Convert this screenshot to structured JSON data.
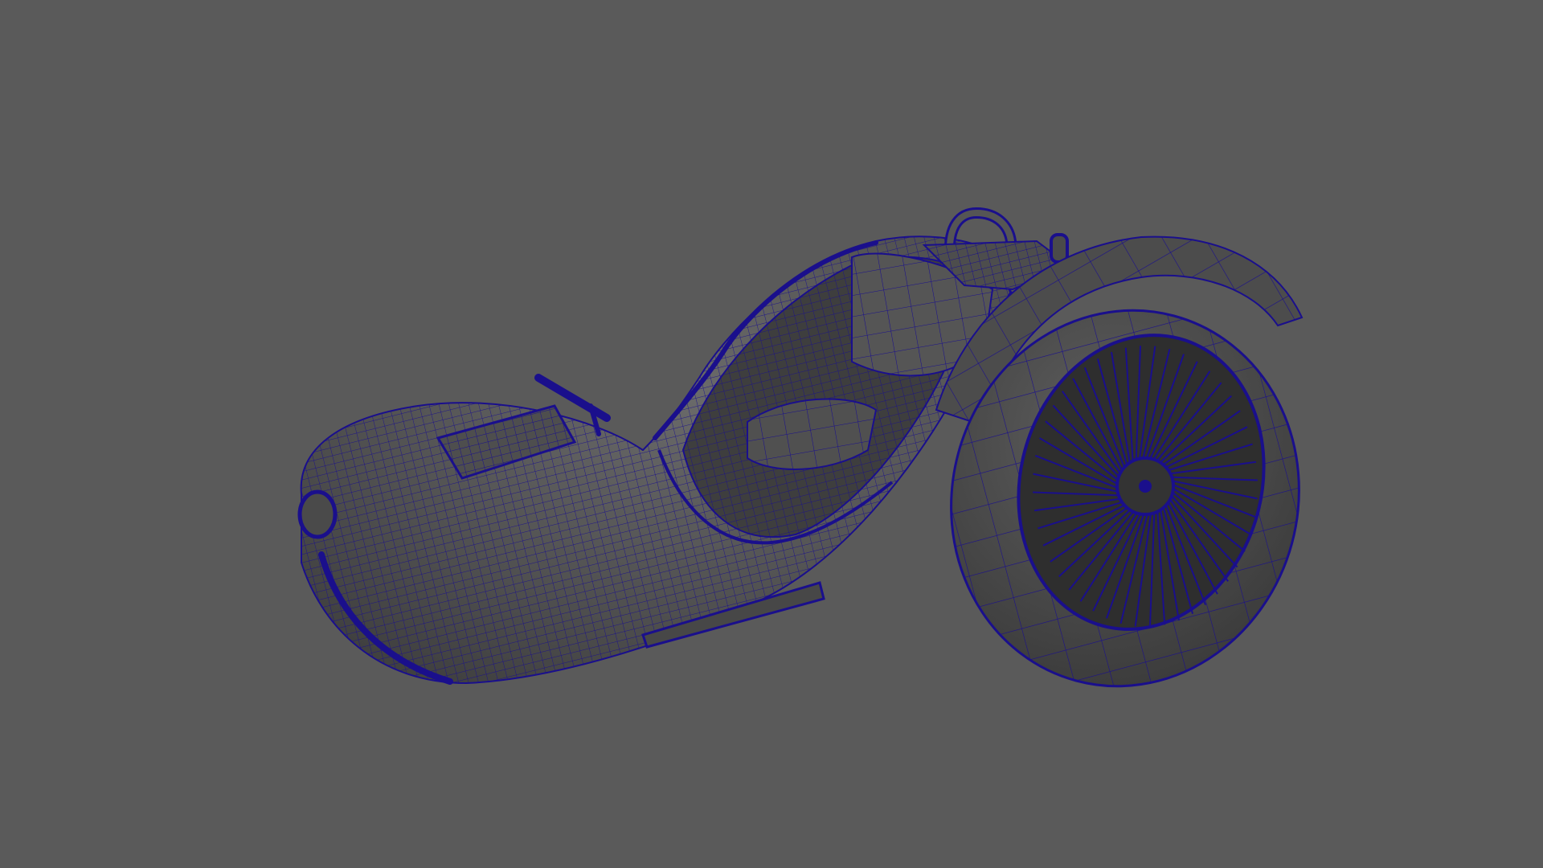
{
  "viewport": {
    "background_color": "#5a5a5a",
    "display_mode": "wireframe-on-shaded",
    "wireframe_color": "#1a0f8c",
    "surface_color": "#4c4c4c",
    "subject": "sidecar-model"
  }
}
